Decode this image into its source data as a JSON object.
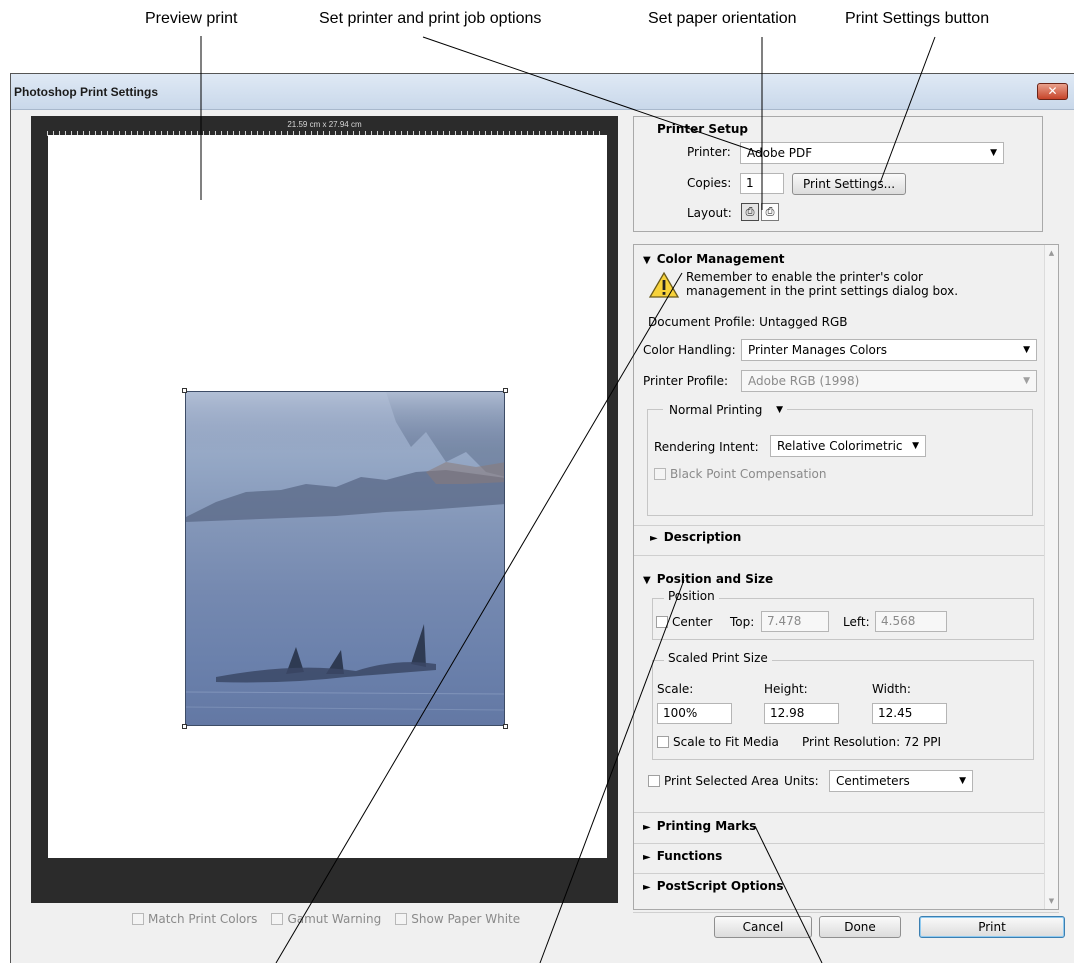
{
  "callouts": {
    "preview": "Preview print",
    "printer_options": "Set printer and print job options",
    "orientation": "Set paper orientation",
    "settings_button": "Print Settings button"
  },
  "window": {
    "title": "Photoshop Print Settings",
    "close_glyph": "✕"
  },
  "preview": {
    "paper_size": "21.59 cm x 27.94 cm",
    "checks": [
      {
        "label": "Match Print Colors"
      },
      {
        "label": "Gamut Warning"
      },
      {
        "label": "Show Paper White"
      }
    ]
  },
  "printer_setup": {
    "title": "Printer Setup",
    "printer_label": "Printer:",
    "printer_value": "Adobe PDF",
    "copies_label": "Copies:",
    "copies_value": "1",
    "settings_button": "Print Settings...",
    "layout_label": "Layout:",
    "layout_icons": [
      "portrait-orientation-icon",
      "landscape-orientation-icon"
    ]
  },
  "color_management": {
    "title": "Color Management",
    "warning": "Remember to enable the printer's color management in the print settings dialog box.",
    "document_profile": "Document Profile: Untagged RGB",
    "handling_label": "Color Handling:",
    "handling_value": "Printer Manages Colors",
    "profile_label": "Printer Profile:",
    "profile_value": "Adobe RGB (1998)",
    "mode_value": "Normal Printing",
    "intent_label": "Rendering Intent:",
    "intent_value": "Relative Colorimetric",
    "black_point": "Black Point Compensation",
    "description": "Description"
  },
  "position_size": {
    "title": "Position and Size",
    "position_legend": "Position",
    "center_label": "Center",
    "top_label": "Top:",
    "top_value": "7.478",
    "left_label": "Left:",
    "left_value": "4.568",
    "scaled_legend": "Scaled Print Size",
    "scale_label": "Scale:",
    "scale_value": "100%",
    "height_label": "Height:",
    "height_value": "12.98",
    "width_label": "Width:",
    "width_value": "12.45",
    "fit_media": "Scale to Fit Media",
    "resolution": "Print Resolution: 72 PPI",
    "selected_area": "Print Selected Area",
    "units_label": "Units:",
    "units_value": "Centimeters"
  },
  "sections": {
    "printing_marks": "Printing Marks",
    "functions": "Functions",
    "postscript": "PostScript Options"
  },
  "buttons": {
    "cancel": "Cancel",
    "done": "Done",
    "print": "Print"
  },
  "colors": {
    "accent": "#3399ff",
    "preview_bg": "#2b2b2b",
    "titlebar": "#dfe9f5"
  }
}
